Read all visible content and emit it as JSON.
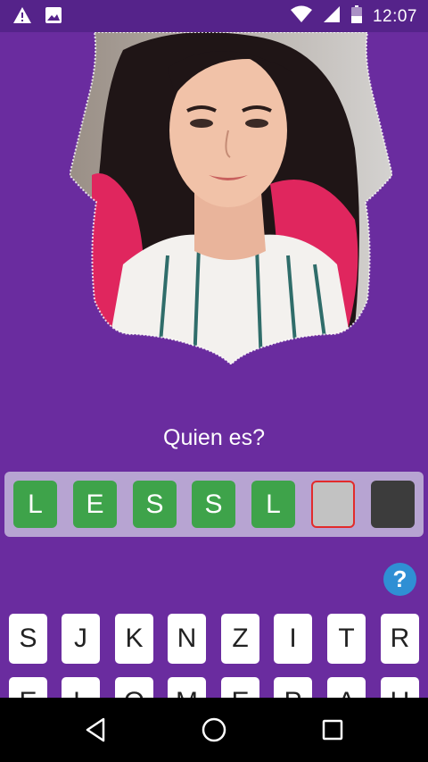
{
  "status_bar": {
    "time": "12:07",
    "icons": [
      "warning-icon",
      "image-icon",
      "wifi-icon",
      "signal-icon",
      "battery-icon"
    ]
  },
  "photo": {
    "description_icon": "portrait-photo"
  },
  "question": "Quien es?",
  "answer": {
    "slots": [
      {
        "letter": "L",
        "state": "filled"
      },
      {
        "letter": "E",
        "state": "filled"
      },
      {
        "letter": "S",
        "state": "filled"
      },
      {
        "letter": "S",
        "state": "filled"
      },
      {
        "letter": "L",
        "state": "filled"
      },
      {
        "letter": "",
        "state": "selected-empty"
      },
      {
        "letter": "",
        "state": "dark"
      }
    ]
  },
  "help": {
    "label": "?"
  },
  "keyboard": {
    "row1": [
      "S",
      "J",
      "K",
      "N",
      "Z",
      "I",
      "T",
      "R"
    ],
    "row2": [
      "E",
      "L",
      "O",
      "M",
      "E",
      "P",
      "A",
      "U"
    ]
  },
  "colors": {
    "background": "#6a2c9f",
    "status_bar": "#55238a",
    "filled_slot": "#3ea34a",
    "answer_bar": "#b7a4d2",
    "help": "#2f8fd4"
  },
  "nav": [
    "back-icon",
    "home-icon",
    "recents-icon"
  ]
}
